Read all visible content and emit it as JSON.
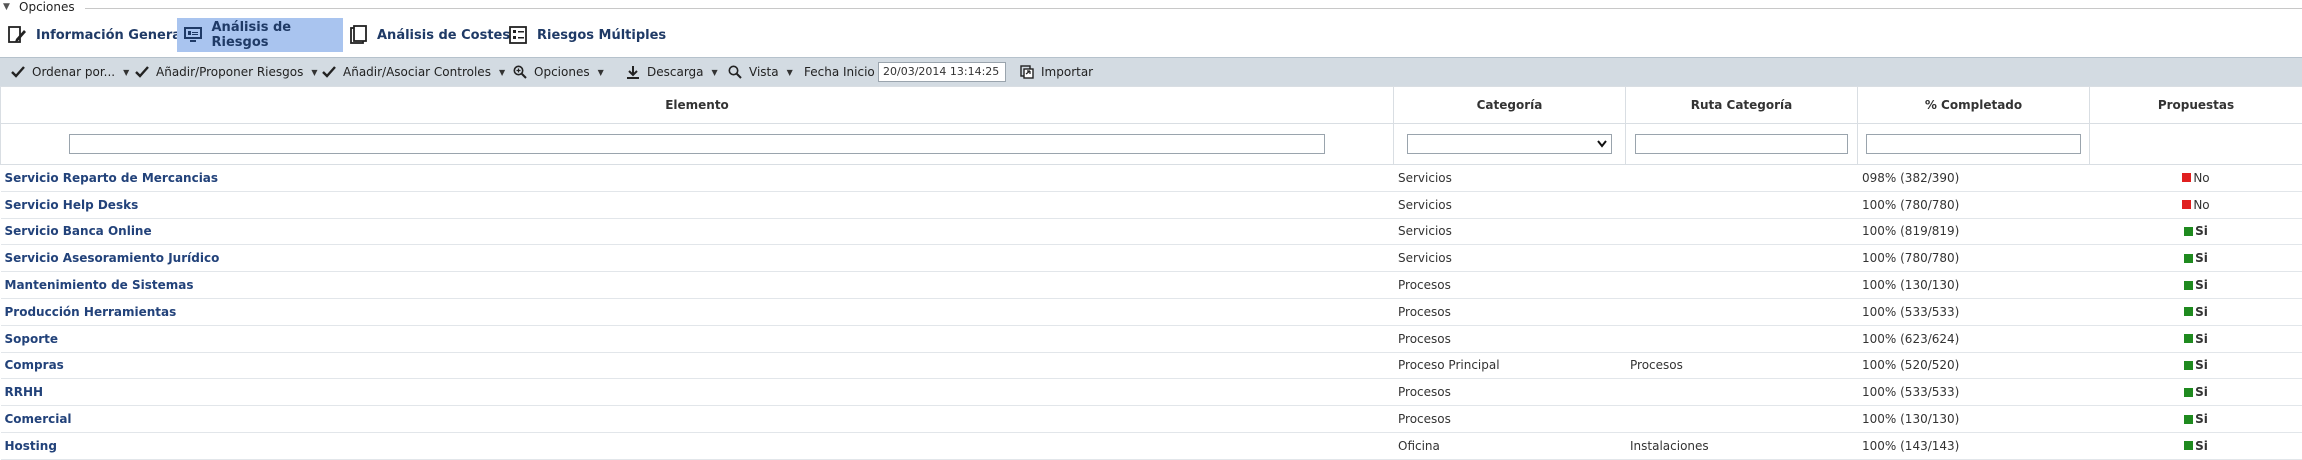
{
  "section": {
    "title": "Opciones"
  },
  "tabs": [
    {
      "label": "Información General",
      "icon": "document-edit-icon",
      "active": false
    },
    {
      "label": "Análisis de Riesgos",
      "icon": "monitor-icon",
      "active": true
    },
    {
      "label": "Análisis de Costes",
      "icon": "clipboard-icon",
      "active": false
    },
    {
      "label": "Riesgos Múltiples",
      "icon": "list-icon",
      "active": false
    }
  ],
  "toolbar": {
    "ordenar": "Ordenar por...",
    "anadir_riesgos": "Añadir/Proponer Riesgos",
    "anadir_controles": "Añadir/Asociar Controles",
    "opciones": "Opciones",
    "descarga": "Descarga",
    "vista": "Vista",
    "fecha_label": "Fecha Inicio",
    "fecha_value": "20/03/2014 13:14:25",
    "importar": "Importar"
  },
  "table": {
    "columns": [
      "Elemento",
      "Categoría",
      "Ruta Categoría",
      "% Completado",
      "Propuestas"
    ],
    "rows": [
      {
        "elemento": "Servicio Reparto de Mercancias",
        "categoria": "Servicios",
        "ruta": "",
        "completado": "098% (382/390)",
        "propuesta": "No"
      },
      {
        "elemento": "Servicio Help Desks",
        "categoria": "Servicios",
        "ruta": "",
        "completado": "100% (780/780)",
        "propuesta": "No"
      },
      {
        "elemento": "Servicio Banca Online",
        "categoria": "Servicios",
        "ruta": "",
        "completado": "100% (819/819)",
        "propuesta": "Si"
      },
      {
        "elemento": "Servicio Asesoramiento Jurídico",
        "categoria": "Servicios",
        "ruta": "",
        "completado": "100% (780/780)",
        "propuesta": "Si"
      },
      {
        "elemento": "Mantenimiento de Sistemas",
        "categoria": "Procesos",
        "ruta": "",
        "completado": "100% (130/130)",
        "propuesta": "Si"
      },
      {
        "elemento": "Producción Herramientas",
        "categoria": "Procesos",
        "ruta": "",
        "completado": "100% (533/533)",
        "propuesta": "Si"
      },
      {
        "elemento": "Soporte",
        "categoria": "Procesos",
        "ruta": "",
        "completado": "100% (623/624)",
        "propuesta": "Si"
      },
      {
        "elemento": "Compras",
        "categoria": "Proceso Principal",
        "ruta": "Procesos",
        "completado": "100% (520/520)",
        "propuesta": "Si"
      },
      {
        "elemento": "RRHH",
        "categoria": "Procesos",
        "ruta": "",
        "completado": "100% (533/533)",
        "propuesta": "Si"
      },
      {
        "elemento": "Comercial",
        "categoria": "Procesos",
        "ruta": "",
        "completado": "100% (130/130)",
        "propuesta": "Si"
      },
      {
        "elemento": "Hosting",
        "categoria": "Oficina",
        "ruta": "Instalaciones",
        "completado": "100% (143/143)",
        "propuesta": "Si"
      }
    ]
  },
  "colors": {
    "no": "#e02020",
    "si": "#1f8a1f",
    "tab_active": "#a9c4ef",
    "link": "#22427a"
  }
}
